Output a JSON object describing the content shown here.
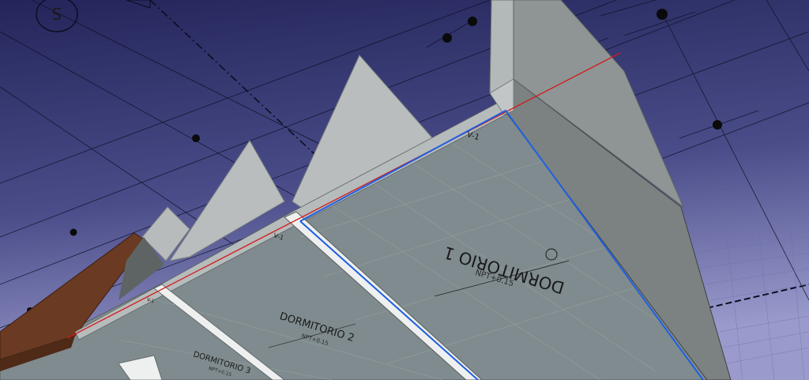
{
  "colors": {
    "sky_top": "#2a2c5a",
    "sky_bottom": "#8e8fc4",
    "floor": "#7e8b8e",
    "wall_light": "#c3c6c6",
    "wall_mid": "#8a9090",
    "wall_dark": "#6b7171",
    "wood": "#6b3a22",
    "axis_red": "#d21a1a",
    "edge_blue": "#1f5fe0"
  },
  "labels": {
    "room1_name": "DORMITORIO 1",
    "room1_level": "NPT+0.15",
    "room2_name": "DORMITORIO 2",
    "room2_level": "NPT+0.15",
    "room3_name": "DORMITORIO 3",
    "room3_level": "NPT+0.15",
    "beam_v1_a": "V-1",
    "beam_v1_b": "V-1",
    "beam_v1_c": "V-1",
    "north_mark": "S"
  },
  "icons": {
    "level_marker": "level-marker-icon",
    "axis_bubble": "grid-axis-bubble-icon"
  }
}
